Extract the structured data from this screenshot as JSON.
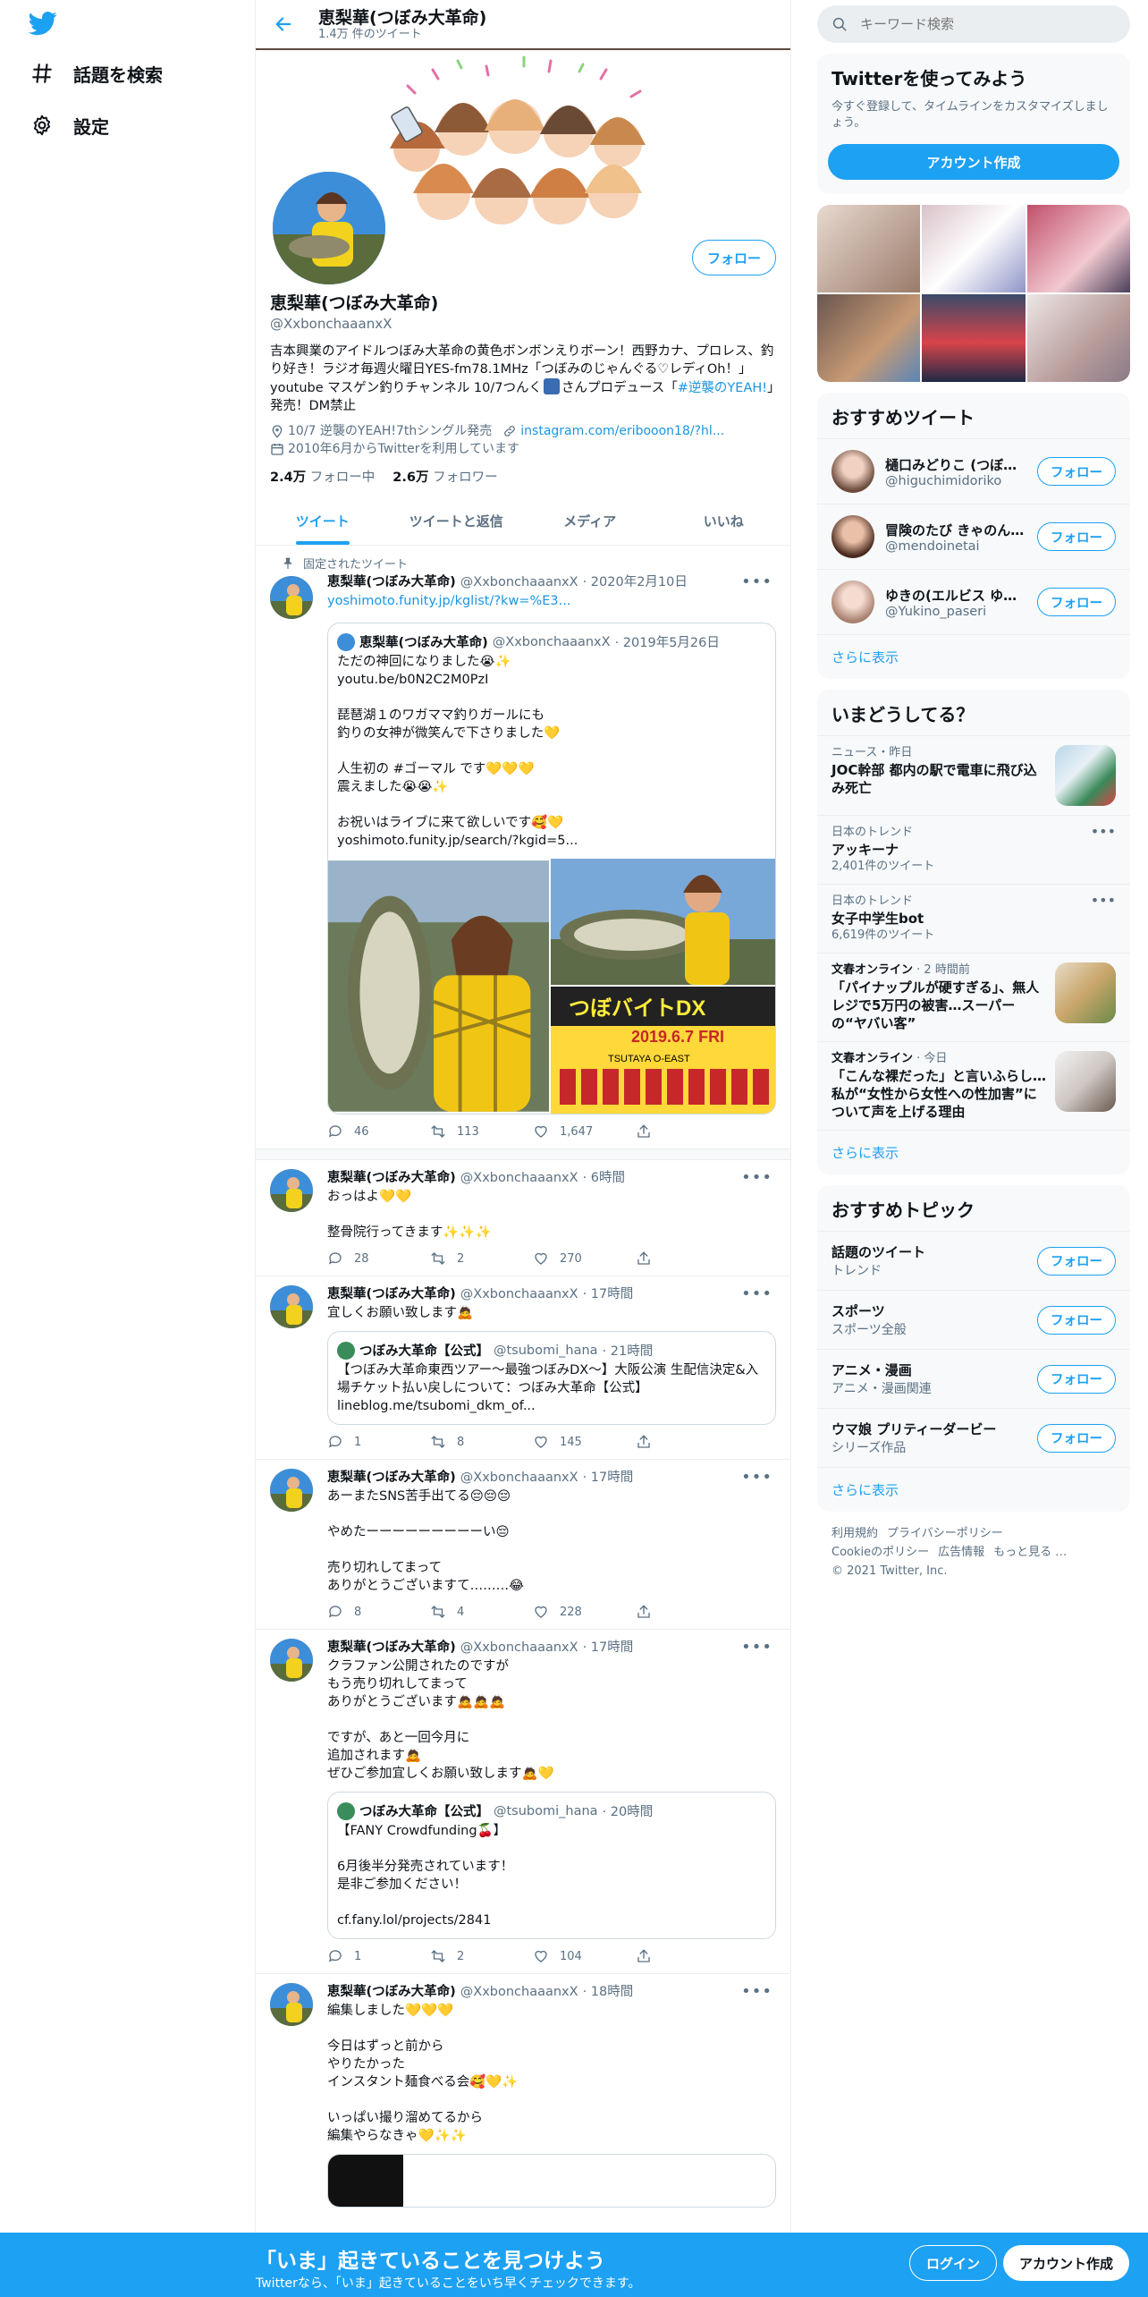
{
  "nav": {
    "explore": "話題を検索",
    "settings": "設定"
  },
  "header": {
    "name": "恵梨華(つぼみ大革命)",
    "count": "1.4万 件のツイート"
  },
  "profile": {
    "name": "恵梨華(つぼみ大革命)",
    "handle": "@XxbonchaaanxX",
    "follow": "フォロー",
    "bio_main": "吉本興業のアイドルつぼみ大革命の黄色ボンボンえりボーン！西野カナ、プロレス、釣り好き！ラジオ毎週火曜日YES-fm78.1MHz「つぼみのじゃんぐる♡レディOh！」youtube マスゲン釣りチャンネル 10/7つんく",
    "bio_mid": "さんプロデュース「",
    "bio_tag": "#逆襲のYEAH!",
    "bio_end": "」発売！DM禁止",
    "location": "10/7 逆襲のYEAH!7thシングル発売",
    "url": "instagram.com/eribooon18/?hl...",
    "joined": "2010年6月からTwitterを利用しています",
    "following_num": "2.4万",
    "following_label": "フォロー中",
    "followers_num": "2.6万",
    "followers_label": "フォロワー"
  },
  "tabs": [
    "ツイート",
    "ツイートと返信",
    "メディア",
    "いいね"
  ],
  "tweets": [
    {
      "pinned": "固定されたツイート",
      "name": "恵梨華(つぼみ大革命)",
      "handle": "@XxbonchaaanxX",
      "time": "· 2020年2月10日",
      "link": "yoshimoto.funity.jp/kglist/?kw=%E3...",
      "quote": {
        "name": "恵梨華(つぼみ大革命)",
        "handle": "@XxbonchaaanxX",
        "time": "· 2019年5月26日",
        "text": "ただの神回になりました😭✨\nyoutu.be/b0N2C2M0PzI\n\n琵琶湖１のワガママ釣りガールにも\n釣りの女神が微笑んで下さりました💛\n\n人生初の #ゴーマル です💛💛💛\n震えました😭😭✨\n\nお祝いはライブに来て欲しいです🥰💛\nyoshimoto.funity.jp/search/?kgid=5..."
      },
      "replies": "46",
      "retweets": "113",
      "likes": "1,647"
    },
    {
      "name": "恵梨華(つぼみ大革命)",
      "handle": "@XxbonchaaanxX",
      "time": "· 6時間",
      "text": "おっはよ💛💛\n\n整骨院行ってきます✨✨✨",
      "replies": "28",
      "retweets": "2",
      "likes": "270"
    },
    {
      "name": "恵梨華(つぼみ大革命)",
      "handle": "@XxbonchaaanxX",
      "time": "· 17時間",
      "text": "宜しくお願い致します🙇",
      "quote": {
        "name": "つぼみ大革命【公式】",
        "handle": "@tsubomi_hana",
        "time": "· 21時間",
        "text": "【つぼみ大革命東西ツアー～最強つぼみDX～】大阪公演 生配信決定&入場チケット払い戻しについて：つぼみ大革命【公式】\nlineblog.me/tsubomi_dkm_of..."
      },
      "replies": "1",
      "retweets": "8",
      "likes": "145"
    },
    {
      "name": "恵梨華(つぼみ大革命)",
      "handle": "@XxbonchaaanxX",
      "time": "· 17時間",
      "text": "あーまたSNS苦手出てる😔😔😔\n\nやめたーーーーーーーーーい😔\n\n売り切れしてまって\nありがとうございますて………😂",
      "replies": "8",
      "retweets": "4",
      "likes": "228"
    },
    {
      "name": "恵梨華(つぼみ大革命)",
      "handle": "@XxbonchaaanxX",
      "time": "· 17時間",
      "text": "クラファン公開されたのですが\nもう売り切れしてまって\nありがとうございます🙇🙇🙇\n\nですが、あと一回今月に\n追加されます🙇\nぜひご参加宜しくお願い致します🙇💛",
      "quote": {
        "name": "つぼみ大革命【公式】",
        "handle": "@tsubomi_hana",
        "time": "· 20時間",
        "text": "【FANY Crowdfunding🍒】\n\n6月後半分発売されています！\n是非ご参加ください！\n\ncf.fany.lol/projects/2841"
      },
      "replies": "1",
      "retweets": "2",
      "likes": "104"
    },
    {
      "name": "恵梨華(つぼみ大革命)",
      "handle": "@XxbonchaaanxX",
      "time": "· 18時間",
      "text": "編集しました💛💛💛\n\n今日はずっと前から\nやりたかった\nインスタント麺食べる会🥰💛✨\n\nいっぱい撮り溜めてるから\n編集やらなきゃ💛✨✨"
    }
  ],
  "right": {
    "search_placeholder": "キーワード検索",
    "signup_card": {
      "title": "Twitterを使ってみよう",
      "sub": "今すぐ登録して、タイムラインをカスタマイズしましょう。",
      "cta": "アカウント作成"
    },
    "recommend": {
      "title": "おすすめツイート",
      "follow": "フォロー",
      "more": "さらに表示",
      "users": [
        {
          "name": "樋口みどりこ (つぼ…",
          "handle": "@higuchimidoriko"
        },
        {
          "name": "冒険のたび きゃのん…",
          "handle": "@mendoinetai"
        },
        {
          "name": "ゆきの(エルビス ゆ…",
          "handle": "@Yukino_paseri"
        }
      ]
    },
    "trends": {
      "title": "いまどうしてる？",
      "more": "さらに表示",
      "items": [
        {
          "context": "ニュース・昨日",
          "name": "JOC幹部 都内の駅で電車に飛び込み死亡",
          "count": ""
        },
        {
          "context": "日本のトレンド",
          "name": "アッキーナ",
          "count": "2,401件のツイート"
        },
        {
          "context": "日本のトレンド",
          "name": "女子中学生bot",
          "count": "6,619件のツイート"
        },
        {
          "context": "文春オンライン",
          "meta": "· 2 時間前",
          "name": "「パイナップルが硬すぎる」、無人レジで5万円の被害…スーパーの“ヤバい客”",
          "count": ""
        },
        {
          "context": "文春オンライン",
          "meta": "· 今日",
          "name": "「こんな裸だった」と言いふらし…私が“女性から女性への性加害”について声を上げる理由",
          "count": ""
        }
      ]
    },
    "topics": {
      "title": "おすすめトピック",
      "follow": "フォロー",
      "more": "さらに表示",
      "items": [
        {
          "name": "話題のツイート",
          "sub": "トレンド"
        },
        {
          "name": "スポーツ",
          "sub": "スポーツ全般"
        },
        {
          "name": "アニメ・漫画",
          "sub": "アニメ・漫画関連"
        },
        {
          "name": "ウマ娘 プリティーダービー",
          "sub": "シリーズ作品"
        }
      ]
    },
    "footer": {
      "terms": "利用規約",
      "privacy": "プライバシーポリシー",
      "cookie": "Cookieのポリシー",
      "ads": "広告情報",
      "more": "もっと見る …",
      "copy": "© 2021 Twitter, Inc."
    }
  },
  "bottom": {
    "title": "「いま」起きていることを見つけよう",
    "sub": "Twitterなら、「いま」起きていることをいち早くチェックできます。",
    "login": "ログイン",
    "signup": "アカウント作成"
  },
  "colors": {
    "accent": "#1da1f2",
    "text": "#0f1419",
    "muted": "#5b7083"
  }
}
